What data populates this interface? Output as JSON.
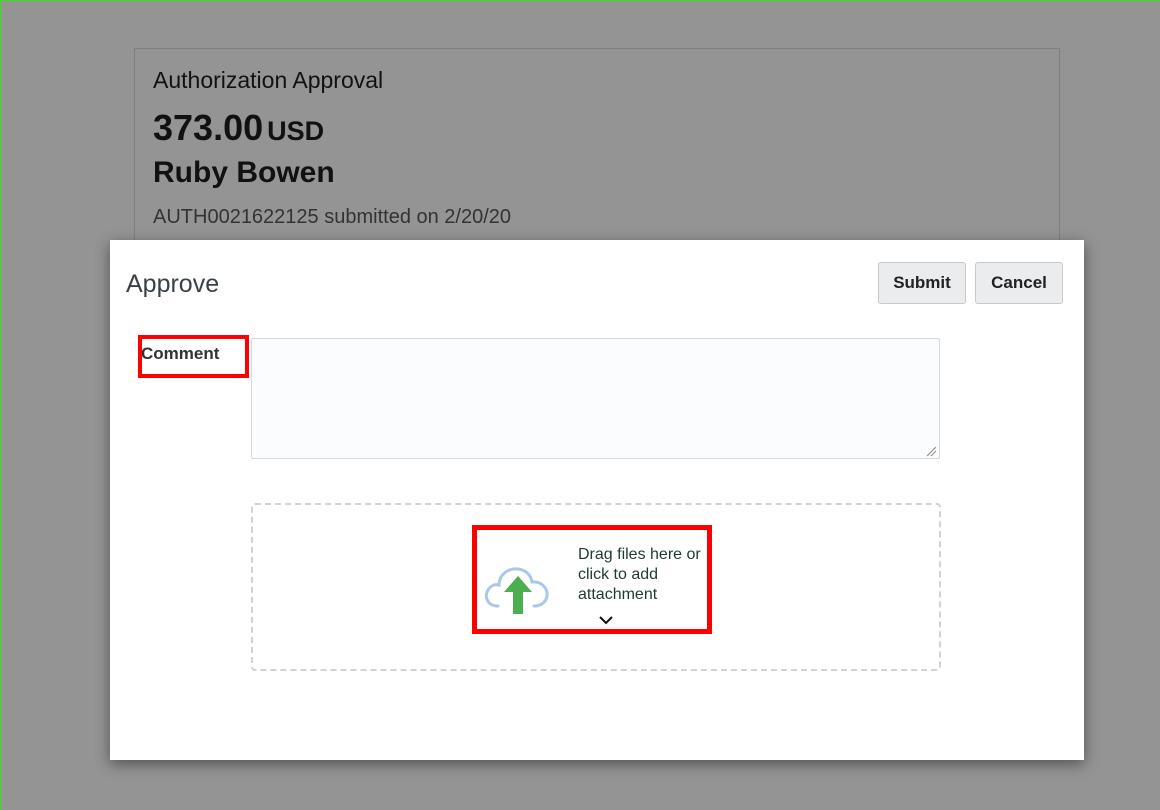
{
  "background_card": {
    "title": "Authorization Approval",
    "amount": "373.00",
    "currency": "USD",
    "name": "Ruby Bowen",
    "meta": "AUTH0021622125 submitted on 2/20/20"
  },
  "dialog": {
    "title": "Approve",
    "submit_label": "Submit",
    "cancel_label": "Cancel",
    "comment_label": "Comment",
    "comment_value": "",
    "dropzone_text": "Drag files here or click to add attachment"
  },
  "icons": {
    "upload": "cloud-upload-icon",
    "expand": "chevron-down-icon",
    "resize": "resize-grip-icon"
  },
  "colors": {
    "overlay": "#949494",
    "highlight": "#ff0000",
    "upload_arrow": "#4cae4f",
    "cloud_outline": "#a9c8e8",
    "frame_border": "#5fc24f"
  }
}
